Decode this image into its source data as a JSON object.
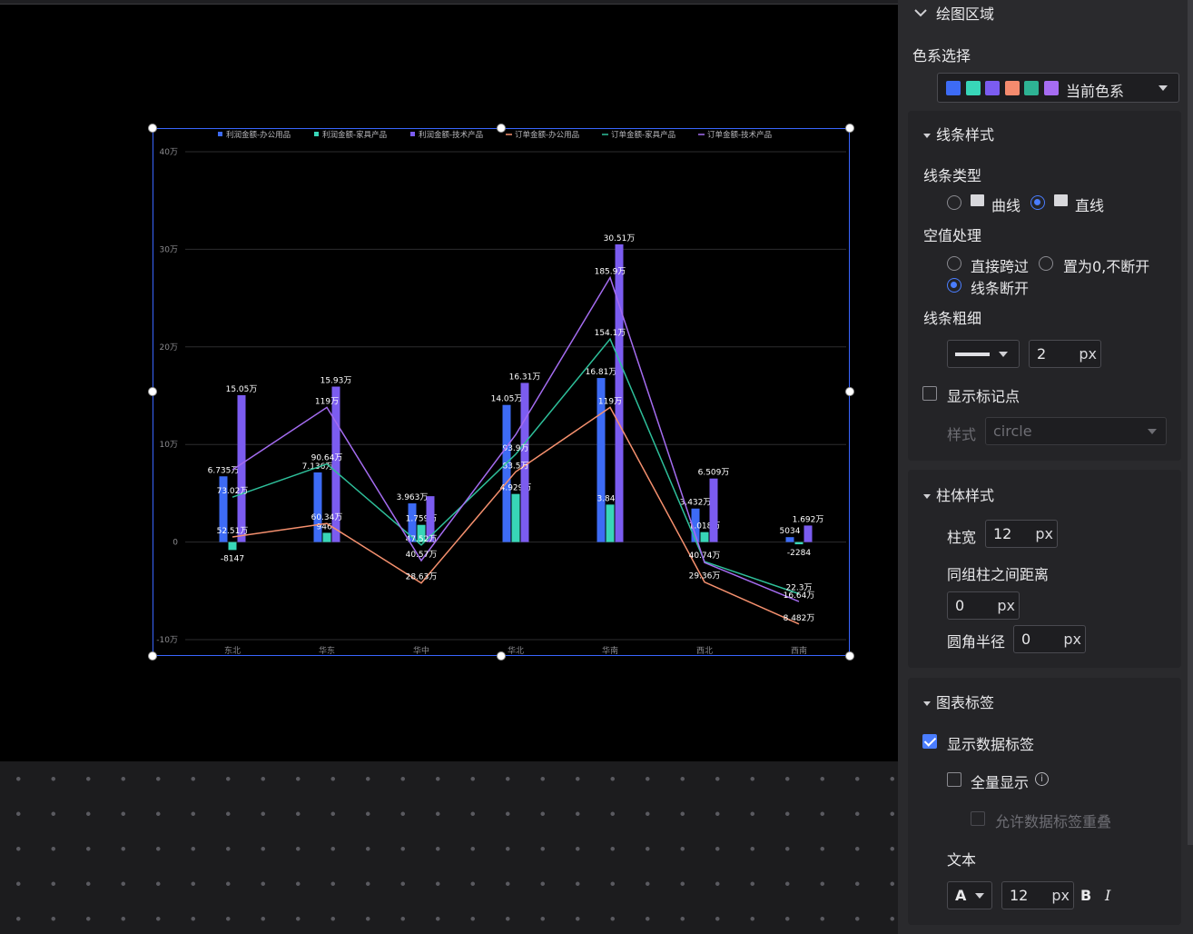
{
  "panel": {
    "section_title": "绘图区域",
    "color_scheme_label": "色系选择",
    "color_scheme_value": "当前色系",
    "palette": [
      "#3d6bf5",
      "#38d6b8",
      "#7b5cf0",
      "#f58b6e",
      "#2eb394",
      "#a66cf2"
    ],
    "line_style": {
      "title": "线条样式",
      "type_label": "线条类型",
      "type_curve": "曲线",
      "type_straight": "直线",
      "null_label": "空值处理",
      "null_skip": "直接跨过",
      "null_zero": "置为0,不断开",
      "null_break": "线条断开",
      "width_label": "线条粗细",
      "width_value": "2",
      "unit": "px",
      "show_marker": "显示标记点",
      "marker_style_label": "样式",
      "marker_style_value": "circle"
    },
    "bar_style": {
      "title": "柱体样式",
      "width_label": "柱宽",
      "width_value": "12",
      "gap_label": "同组柱之间距离",
      "gap_value": "0",
      "radius_label": "圆角半径",
      "radius_value": "0",
      "unit": "px"
    },
    "chart_label": {
      "title": "图表标签",
      "show_data_label": "显示数据标签",
      "show_all": "全量显示",
      "allow_overlap": "允许数据标签重叠",
      "text_label": "文本",
      "font_icon": "A",
      "font_size": "12",
      "unit": "px",
      "bold": "B",
      "italic": "I"
    }
  },
  "chart_data": {
    "type": "bar",
    "categories": [
      "东北",
      "华东",
      "华中",
      "华北",
      "华南",
      "西北",
      "西南"
    ],
    "ylim": [
      -10,
      40
    ],
    "yticks": [
      -10,
      0,
      10,
      20,
      30,
      40
    ],
    "ytick_labels": [
      "-10万",
      "0",
      "10万",
      "20万",
      "30万",
      "40万"
    ],
    "legend": [
      "利润金额-办公用品",
      "利润金额-家具产品",
      "利润金额-技术产品",
      "订单金额-办公用品",
      "订单金额-家具产品",
      "订单金额-技术产品"
    ],
    "bar_series": [
      {
        "name": "利润金额-办公用品",
        "color": "#3d6bf5",
        "values": [
          6.735,
          7.136,
          3.963,
          14.05,
          16.81,
          3.432,
          0.5034
        ],
        "labels": [
          "6.735万",
          "7.136万",
          "3.963万",
          "14.05万",
          "16.81万",
          "3.432万",
          "5034"
        ]
      },
      {
        "name": "利润金额-家具产品",
        "color": "#38d6b8",
        "values": [
          -0.8147,
          0.9467,
          1.759,
          4.929,
          3.84,
          1.018,
          -0.2284
        ],
        "labels": [
          "-8147",
          "9467",
          "1.759万",
          "4.929万",
          "3.84万",
          "1.018万",
          "-2284"
        ]
      },
      {
        "name": "利润金额-技术产品",
        "color": "#7b5cf0",
        "values": [
          15.05,
          15.93,
          4.7,
          16.31,
          30.51,
          6.509,
          1.692
        ],
        "labels": [
          "15.05万",
          "15.93万",
          "",
          "16.31万",
          "30.51万",
          "6.509万",
          "1.692万"
        ]
      }
    ],
    "line_series": [
      {
        "name": "订单金额-办公用品",
        "color": "#f5906e",
        "values": [
          0.52,
          1.9,
          -4.2,
          7.2,
          13.8,
          -4.1,
          -8.4
        ],
        "labels": [
          "52.51万",
          "60.34万",
          "28.63万",
          "83.5万",
          "119万",
          "29.36万",
          "8.482万"
        ]
      },
      {
        "name": "订单金额-家具产品",
        "color": "#2ebf9a",
        "values": [
          4.6,
          8.0,
          -0.3,
          9.0,
          20.8,
          -2.0,
          -5.3
        ],
        "labels": [
          "73.02万",
          "90.64万",
          "47.52万",
          "93.9万",
          "154.1万",
          "40.74万",
          "22.3万"
        ]
      },
      {
        "name": "订单金额-技术产品",
        "color": "#a46cf0",
        "values": [
          7.4,
          13.8,
          -1.9,
          11.0,
          27.1,
          -2.1,
          -6.1
        ],
        "labels": [
          "",
          "119万",
          "40.57万",
          "",
          "185.9万",
          "",
          "16.64万"
        ]
      }
    ]
  }
}
